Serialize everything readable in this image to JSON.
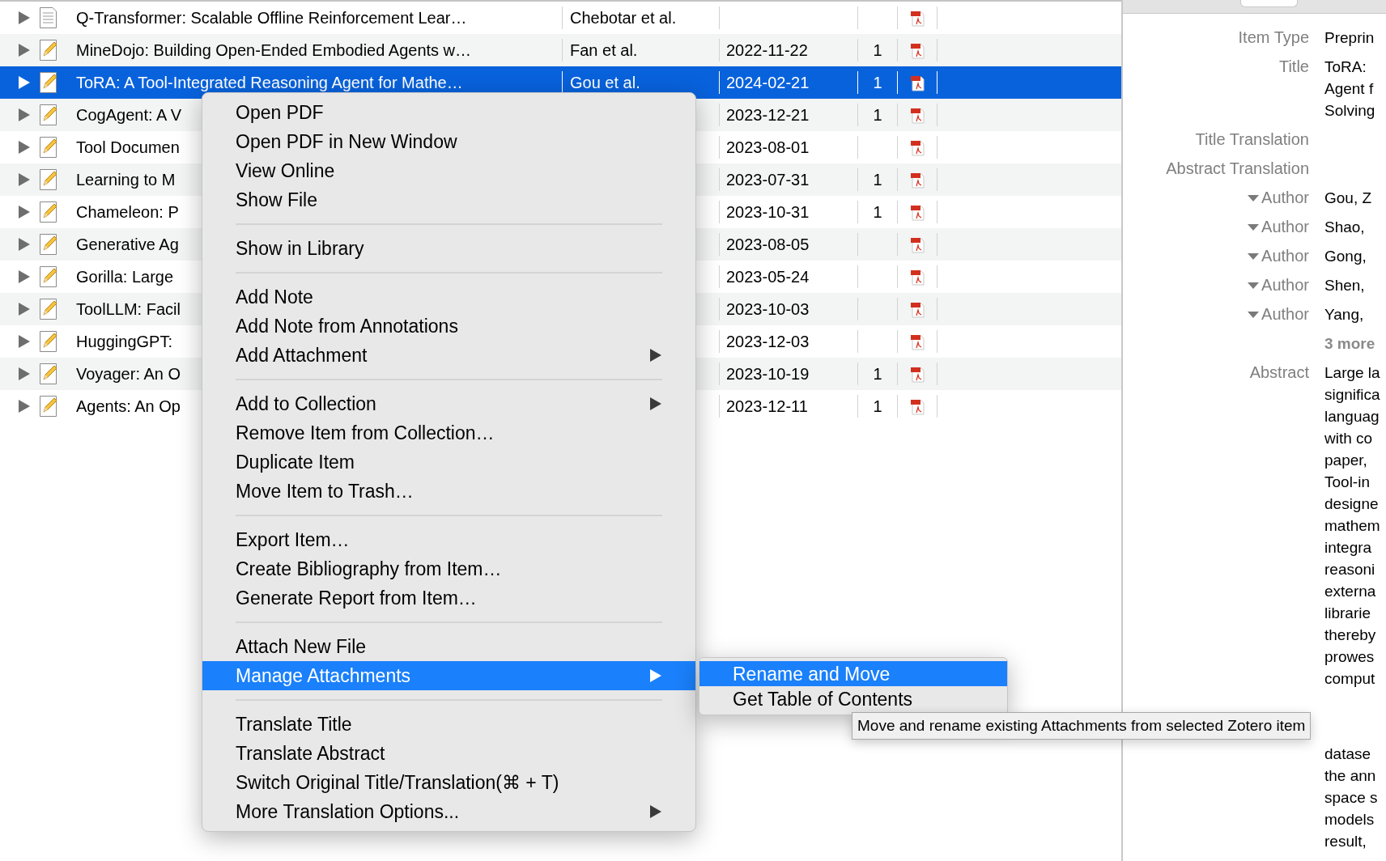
{
  "items_table": {
    "rows": [
      {
        "kind": "document",
        "title": "Q-Transformer: Scalable Offline Reinforcement Lear…",
        "creator": "Chebotar et al.",
        "selected": false
      },
      {
        "kind": "preprint",
        "title": "MineDojo: Building Open-Ended Embodied Agents w…",
        "creator": "Fan et al.",
        "date": "2022-11-22",
        "count": "1",
        "selected": false
      },
      {
        "kind": "preprint",
        "title": "ToRA: A Tool-Integrated Reasoning Agent for Mathe…",
        "creator": "Gou et al.",
        "date": "2024-02-21",
        "count": "1",
        "selected": true
      },
      {
        "kind": "preprint",
        "title": "CogAgent: A V",
        "date": "2023-12-21",
        "count": "1",
        "selected": false
      },
      {
        "kind": "preprint",
        "title": "Tool Documen",
        "date": "2023-08-01",
        "selected": false
      },
      {
        "kind": "preprint",
        "title": "Learning to M",
        "date": "2023-07-31",
        "count": "1",
        "selected": false
      },
      {
        "kind": "preprint",
        "title": "Chameleon: P",
        "date": "2023-10-31",
        "count": "1",
        "selected": false
      },
      {
        "kind": "preprint",
        "title": "Generative Ag",
        "date": "2023-08-05",
        "selected": false
      },
      {
        "kind": "preprint",
        "title": "Gorilla: Large",
        "date": "2023-05-24",
        "selected": false
      },
      {
        "kind": "preprint",
        "title": "ToolLLM: Facil",
        "date": "2023-10-03",
        "selected": false
      },
      {
        "kind": "preprint",
        "title": "HuggingGPT:",
        "date": "2023-12-03",
        "selected": false
      },
      {
        "kind": "preprint",
        "title": "Voyager: An O",
        "date": "2023-10-19",
        "count": "1",
        "selected": false
      },
      {
        "kind": "preprint",
        "title": "Agents: An Op",
        "date": "2023-12-11",
        "count": "1",
        "selected": false
      }
    ]
  },
  "context_menu": {
    "entries": [
      {
        "kind": "item",
        "label": "Open PDF",
        "has_submenu": false,
        "selected": false
      },
      {
        "kind": "item",
        "label": "Open PDF in New Window",
        "has_submenu": false,
        "selected": false
      },
      {
        "kind": "item",
        "label": "View Online",
        "has_submenu": false,
        "selected": false
      },
      {
        "kind": "item",
        "label": "Show File",
        "has_submenu": false,
        "selected": false
      },
      {
        "kind": "separator"
      },
      {
        "kind": "item",
        "label": "Show in Library",
        "has_submenu": false,
        "selected": false
      },
      {
        "kind": "separator"
      },
      {
        "kind": "item",
        "label": "Add Note",
        "has_submenu": false,
        "selected": false
      },
      {
        "kind": "item",
        "label": "Add Note from Annotations",
        "has_submenu": false,
        "selected": false
      },
      {
        "kind": "item",
        "label": "Add Attachment",
        "has_submenu": true,
        "selected": false
      },
      {
        "kind": "separator"
      },
      {
        "kind": "item",
        "label": "Add to Collection",
        "has_submenu": true,
        "selected": false
      },
      {
        "kind": "item",
        "label": "Remove Item from Collection…",
        "has_submenu": false,
        "selected": false
      },
      {
        "kind": "item",
        "label": "Duplicate Item",
        "has_submenu": false,
        "selected": false
      },
      {
        "kind": "item",
        "label": "Move Item to Trash…",
        "has_submenu": false,
        "selected": false
      },
      {
        "kind": "separator"
      },
      {
        "kind": "item",
        "label": "Export Item…",
        "has_submenu": false,
        "selected": false
      },
      {
        "kind": "item",
        "label": "Create Bibliography from Item…",
        "has_submenu": false,
        "selected": false
      },
      {
        "kind": "item",
        "label": "Generate Report from Item…",
        "has_submenu": false,
        "selected": false
      },
      {
        "kind": "separator"
      },
      {
        "kind": "item",
        "label": "Attach New File",
        "has_submenu": false,
        "selected": false
      },
      {
        "kind": "item",
        "label": "Manage Attachments",
        "has_submenu": true,
        "selected": true
      },
      {
        "kind": "separator"
      },
      {
        "kind": "item",
        "label": "Translate Title",
        "has_submenu": false,
        "selected": false
      },
      {
        "kind": "item",
        "label": "Translate Abstract",
        "has_submenu": false,
        "selected": false
      },
      {
        "kind": "item",
        "label": "Switch Original Title/Translation(⌘ + T)",
        "has_submenu": false,
        "selected": false
      },
      {
        "kind": "item",
        "label": "More Translation Options...",
        "has_submenu": true,
        "selected": false
      }
    ]
  },
  "submenu": {
    "items": [
      {
        "label": "Rename and Move",
        "selected": true
      },
      {
        "label": "Get Table of Contents",
        "selected": false
      }
    ]
  },
  "tooltip": {
    "text": "Move and rename existing Attachments from selected Zotero item"
  },
  "item_pane": {
    "fields": [
      {
        "kind": "field",
        "label": "Item Type",
        "lines": [
          "Preprin"
        ]
      },
      {
        "kind": "field",
        "label": "Title",
        "lines": [
          "ToRA:",
          "Agent f",
          "Solving"
        ]
      },
      {
        "kind": "field",
        "label": "Title Translation"
      },
      {
        "kind": "field",
        "label": "Abstract Translation"
      },
      {
        "kind": "creator",
        "label": "Author",
        "lines": [
          "Gou, Z"
        ]
      },
      {
        "kind": "creator",
        "label": "Author",
        "lines": [
          "Shao,"
        ]
      },
      {
        "kind": "creator",
        "label": "Author",
        "lines": [
          "Gong,"
        ]
      },
      {
        "kind": "creator",
        "label": "Author",
        "lines": [
          "Shen,"
        ]
      },
      {
        "kind": "creator",
        "label": "Author",
        "lines": [
          "Yang,"
        ]
      },
      {
        "kind": "more",
        "lines": [
          "3 more"
        ]
      },
      {
        "kind": "field",
        "label": "Abstract",
        "lines": [
          "Large la",
          "significa",
          "languag",
          "with co",
          "paper,",
          "Tool-in",
          "designe",
          "mathem",
          "integra",
          "reasoni",
          "externa",
          "librarie",
          "thereby",
          "prowes",
          "comput"
        ],
        "lines_after_tooltip": [
          "datase",
          "the ann",
          "space s",
          "models",
          "result,"
        ]
      }
    ]
  }
}
